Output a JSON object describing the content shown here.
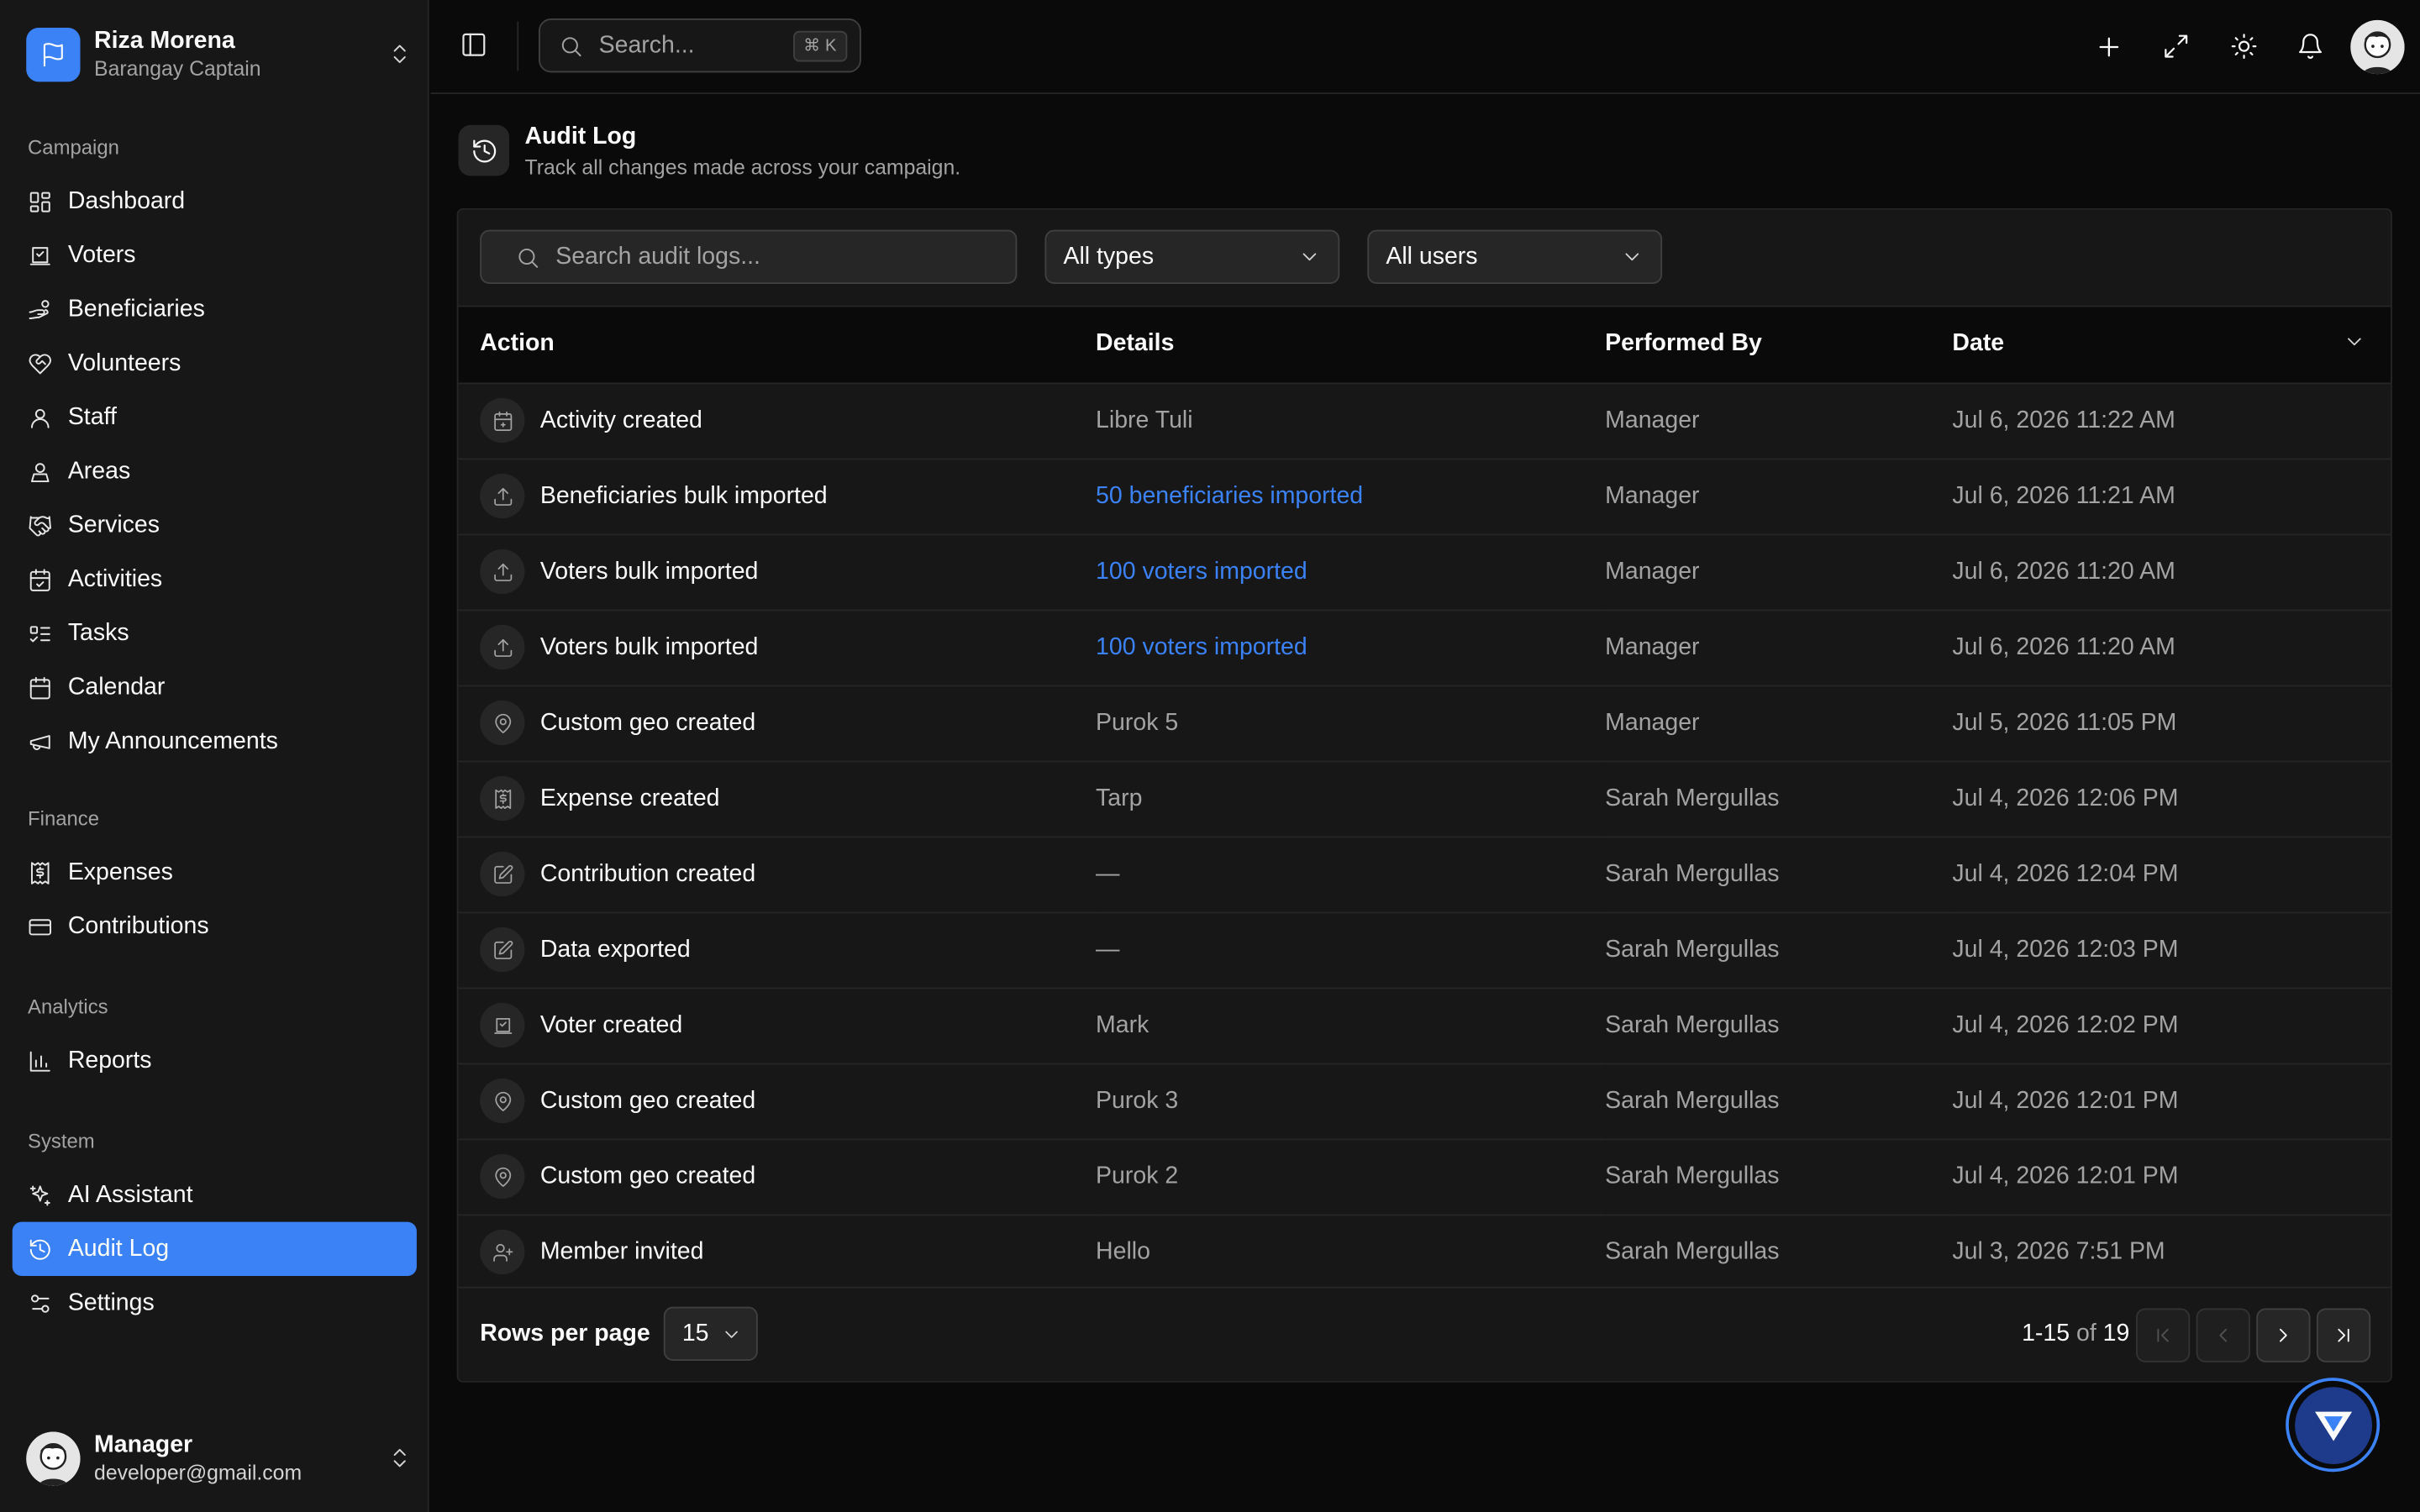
{
  "team": {
    "name": "Riza Morena",
    "role": "Barangay Captain"
  },
  "nav": {
    "campaign_label": "Campaign",
    "campaign": [
      {
        "label": "Dashboard",
        "icon": "dashboard-icon"
      },
      {
        "label": "Voters",
        "icon": "ballot-icon"
      },
      {
        "label": "Beneficiaries",
        "icon": "hand-coins-icon"
      },
      {
        "label": "Volunteers",
        "icon": "heart-handshake-icon"
      },
      {
        "label": "Staff",
        "icon": "user-icon"
      },
      {
        "label": "Areas",
        "icon": "map-user-icon"
      },
      {
        "label": "Services",
        "icon": "handshake-icon"
      },
      {
        "label": "Activities",
        "icon": "calendar-check-icon"
      },
      {
        "label": "Tasks",
        "icon": "list-todo-icon"
      },
      {
        "label": "Calendar",
        "icon": "calendar-icon"
      },
      {
        "label": "My Announcements",
        "icon": "megaphone-icon"
      }
    ],
    "finance_label": "Finance",
    "finance": [
      {
        "label": "Expenses",
        "icon": "receipt-icon"
      },
      {
        "label": "Contributions",
        "icon": "credit-card-icon"
      }
    ],
    "analytics_label": "Analytics",
    "analytics": [
      {
        "label": "Reports",
        "icon": "bar-chart-icon"
      }
    ],
    "system_label": "System",
    "system": [
      {
        "label": "AI Assistant",
        "icon": "sparkles-icon"
      },
      {
        "label": "Audit Log",
        "icon": "history-icon"
      },
      {
        "label": "Settings",
        "icon": "settings-icon"
      }
    ]
  },
  "user": {
    "name": "Manager",
    "email": "developer@gmail.com"
  },
  "header": {
    "search_placeholder": "Search...",
    "shortcut": "⌘ K"
  },
  "page": {
    "title": "Audit Log",
    "subtitle": "Track all changes made across your campaign."
  },
  "filters": {
    "search_placeholder": "Search audit logs...",
    "type": "All types",
    "user": "All users"
  },
  "table": {
    "columns": [
      "Action",
      "Details",
      "Performed By",
      "Date"
    ],
    "rows": [
      {
        "icon": "calendar-plus-icon",
        "action": "Activity created",
        "details": "Libre Tuli",
        "link": false,
        "by": "Manager",
        "date": "Jul 6, 2026 11:22 AM"
      },
      {
        "icon": "upload-icon",
        "action": "Beneficiaries bulk imported",
        "details": "50 beneficiaries imported",
        "link": true,
        "by": "Manager",
        "date": "Jul 6, 2026 11:21 AM"
      },
      {
        "icon": "upload-icon",
        "action": "Voters bulk imported",
        "details": "100 voters imported",
        "link": true,
        "by": "Manager",
        "date": "Jul 6, 2026 11:20 AM"
      },
      {
        "icon": "upload-icon",
        "action": "Voters bulk imported",
        "details": "100 voters imported",
        "link": true,
        "by": "Manager",
        "date": "Jul 6, 2026 11:20 AM"
      },
      {
        "icon": "map-pin-icon",
        "action": "Custom geo created",
        "details": "Purok 5",
        "link": false,
        "by": "Manager",
        "date": "Jul 5, 2026 11:05 PM"
      },
      {
        "icon": "receipt-icon",
        "action": "Expense created",
        "details": "Tarp",
        "link": false,
        "by": "Sarah Mergullas",
        "date": "Jul 4, 2026 12:06 PM"
      },
      {
        "icon": "edit-icon",
        "action": "Contribution created",
        "details": "—",
        "link": false,
        "by": "Sarah Mergullas",
        "date": "Jul 4, 2026 12:04 PM"
      },
      {
        "icon": "edit-icon",
        "action": "Data exported",
        "details": "—",
        "link": false,
        "by": "Sarah Mergullas",
        "date": "Jul 4, 2026 12:03 PM"
      },
      {
        "icon": "ballot-icon",
        "action": "Voter created",
        "details": "Mark",
        "link": false,
        "by": "Sarah Mergullas",
        "date": "Jul 4, 2026 12:02 PM"
      },
      {
        "icon": "map-pin-icon",
        "action": "Custom geo created",
        "details": "Purok 3",
        "link": false,
        "by": "Sarah Mergullas",
        "date": "Jul 4, 2026 12:01 PM"
      },
      {
        "icon": "map-pin-icon",
        "action": "Custom geo created",
        "details": "Purok 2",
        "link": false,
        "by": "Sarah Mergullas",
        "date": "Jul 4, 2026 12:01 PM"
      },
      {
        "icon": "user-plus-icon",
        "action": "Member invited",
        "details": "Hello",
        "link": false,
        "by": "Sarah Mergullas",
        "date": "Jul 3, 2026 7:51 PM"
      }
    ]
  },
  "pagination": {
    "rows_label": "Rows per page",
    "rows_value": "15",
    "range": "1-15",
    "of": "of",
    "total": "19"
  },
  "colors": {
    "accent": "#3b82f6",
    "background": "#0a0a0a",
    "surface": "#171717"
  }
}
